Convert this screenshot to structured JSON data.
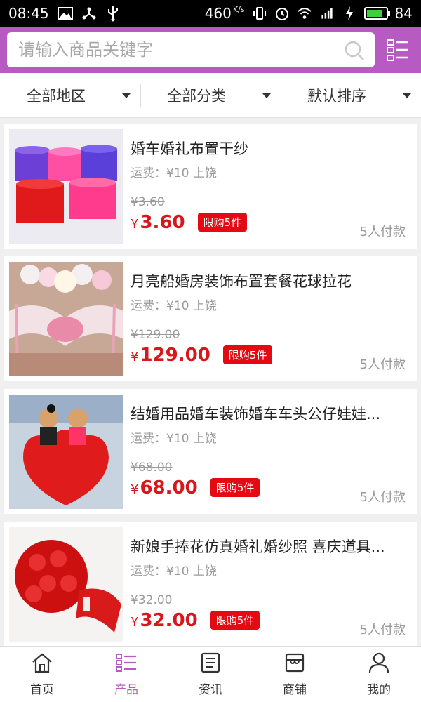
{
  "statusbar": {
    "time": "08:45",
    "speed": "460",
    "speed_unit": "K/s",
    "battery": "84",
    "battery_level": 0.84,
    "left_icons": [
      "image-icon",
      "usb-share-icon",
      "usb-icon"
    ],
    "right_icons": [
      "vibrate-icon",
      "alarm-icon",
      "wifi-icon",
      "4g-signal-icon",
      "charging-icon"
    ]
  },
  "search": {
    "placeholder": "请输入商品关键字",
    "value": ""
  },
  "filters": [
    {
      "label": "全部地区"
    },
    {
      "label": "全部分类"
    },
    {
      "label": "默认排序"
    }
  ],
  "products": [
    {
      "title": "婚车婚礼布置干纱",
      "shipping": "运费：¥10 上饶",
      "original_price": "¥3.60",
      "price_symbol": "¥",
      "price": "3.60",
      "limit": "限购5件",
      "paid": "5人付款"
    },
    {
      "title": "月亮船婚房装饰布置套餐花球拉花",
      "shipping": "运费：¥10 上饶",
      "original_price": "¥129.00",
      "price_symbol": "¥",
      "price": "129.00",
      "limit": "限购5件",
      "paid": "5人付款"
    },
    {
      "title": "结婚用品婚车装饰婚车车头公仔娃娃...",
      "shipping": "运费：¥10 上饶",
      "original_price": "¥68.00",
      "price_symbol": "¥",
      "price": "68.00",
      "limit": "限购5件",
      "paid": "5人付款"
    },
    {
      "title": "新娘手捧花仿真婚礼婚纱照 喜庆道具...",
      "shipping": "运费：¥10 上饶",
      "original_price": "¥32.00",
      "price_symbol": "¥",
      "price": "32.00",
      "limit": "限购5件",
      "paid": "5人付款"
    }
  ],
  "tabs": [
    {
      "label": "首页",
      "icon": "home-icon"
    },
    {
      "label": "产品",
      "icon": "list-icon",
      "active": true
    },
    {
      "label": "资讯",
      "icon": "news-icon"
    },
    {
      "label": "商铺",
      "icon": "store-icon"
    },
    {
      "label": "我的",
      "icon": "user-icon"
    }
  ],
  "colors": {
    "accent": "#b75bc2",
    "price": "#d8161b",
    "badge": "#e50914"
  }
}
